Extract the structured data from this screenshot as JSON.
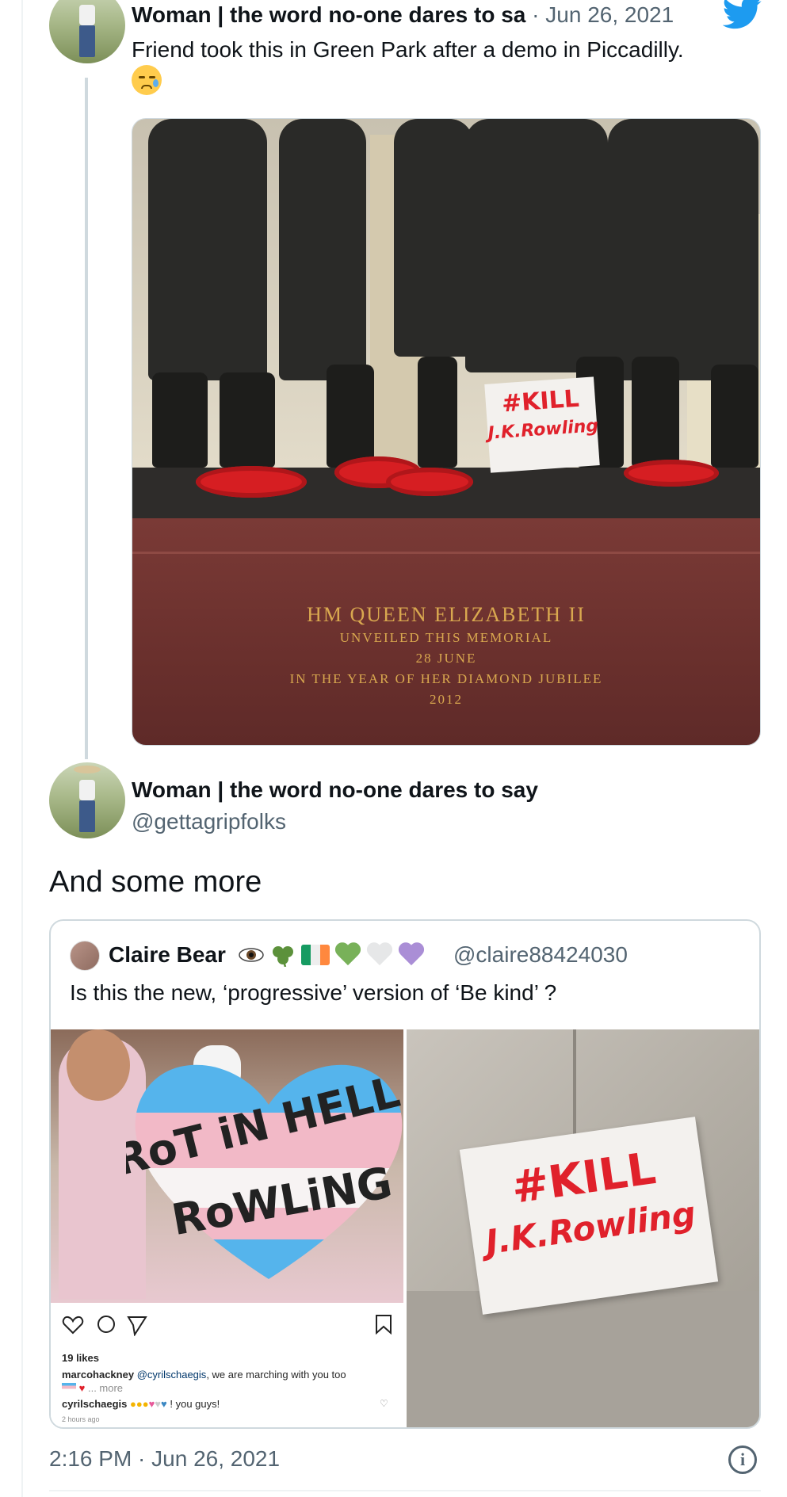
{
  "tweet1": {
    "author_name": "Woman | the word no-one dares to sa",
    "separator": " · ",
    "date": "Jun 26, 2021",
    "text": "Friend took this in Green Park after a demo in Piccadilly.",
    "image": {
      "sign_line1": "#KILL",
      "sign_line2": "J.K.Rowling",
      "inscription_line1": "HM QUEEN ELIZABETH II",
      "inscription_line2": "UNVEILED THIS MEMORIAL",
      "inscription_line3": "28 JUNE",
      "inscription_line4": "IN THE YEAR OF HER DIAMOND JUBILEE",
      "inscription_line5": "2012"
    }
  },
  "tweet2": {
    "author_name": "Woman | the word no-one dares to say",
    "handle": "@gettagripfolks",
    "text": "And some more",
    "timestamp": "2:16 PM · Jun 26, 2021"
  },
  "quoted_tweet": {
    "author_name": "Claire Bear",
    "handle": "@claire88424030",
    "text": "Is this the new, ‘progressive’ version of ‘Be kind’ ?",
    "left_image": {
      "banner_line1": "RoT iN HELL",
      "banner_line2": "RoWLiNG",
      "likes": "19 likes",
      "comment1_user": "marcohackney",
      "comment1_mention": "@cyrilschaegis",
      "comment1_text": ", we are marching with you too",
      "comment1_more": "... more",
      "comment2_user": "cyrilschaegis",
      "comment2_text": "! you guys!",
      "posted_ago": "2 hours ago"
    },
    "right_image": {
      "sign_line1": "#KILL",
      "sign_line2": "J.K.Rowling"
    }
  },
  "colors": {
    "twitter_blue": "#1d9bf0",
    "muted_text": "#536471",
    "border": "#cfd9de",
    "sign_red": "#e0212b"
  }
}
